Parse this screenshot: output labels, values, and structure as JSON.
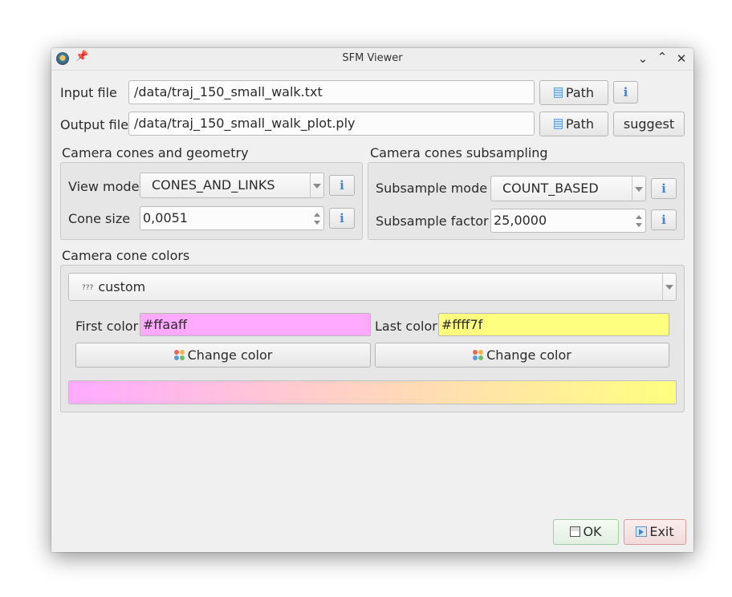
{
  "window": {
    "title": "SFM Viewer",
    "icons": {
      "app": "app-icon",
      "pin": "pin-icon",
      "minimize": "chevron-down-icon",
      "maximize": "chevron-up-icon",
      "close": "close-icon"
    }
  },
  "input": {
    "label": "Input file",
    "value": "/data/traj_150_small_walk.txt",
    "path_button": "Path",
    "info_icon": "info-icon"
  },
  "output": {
    "label": "Output file",
    "value": "/data/traj_150_small_walk_plot.ply",
    "path_button": "Path",
    "suggest_button": "suggest"
  },
  "geometry": {
    "title": "Camera cones and geometry",
    "view_mode_label": "View mode",
    "view_mode_value": "CONES_AND_LINKS",
    "cone_size_label": "Cone size",
    "cone_size_value": "0,0051"
  },
  "subsampling": {
    "title": "Camera cones subsampling",
    "mode_label": "Subsample mode",
    "mode_value": "COUNT_BASED",
    "factor_label": "Subsample factor",
    "factor_value": "25,0000"
  },
  "colors": {
    "title": "Camera cone colors",
    "preset_icon_text": "???",
    "preset_value": "custom",
    "first_label": "First color",
    "first_value": "#ffaaff",
    "last_label": "Last color",
    "last_value": "#ffff7f",
    "change_color_left": "Change color",
    "change_color_right": "Change color",
    "gradient_start": "#ffaaff",
    "gradient_end": "#ffff7f"
  },
  "footer": {
    "ok_label": "OK",
    "exit_label": "Exit"
  }
}
